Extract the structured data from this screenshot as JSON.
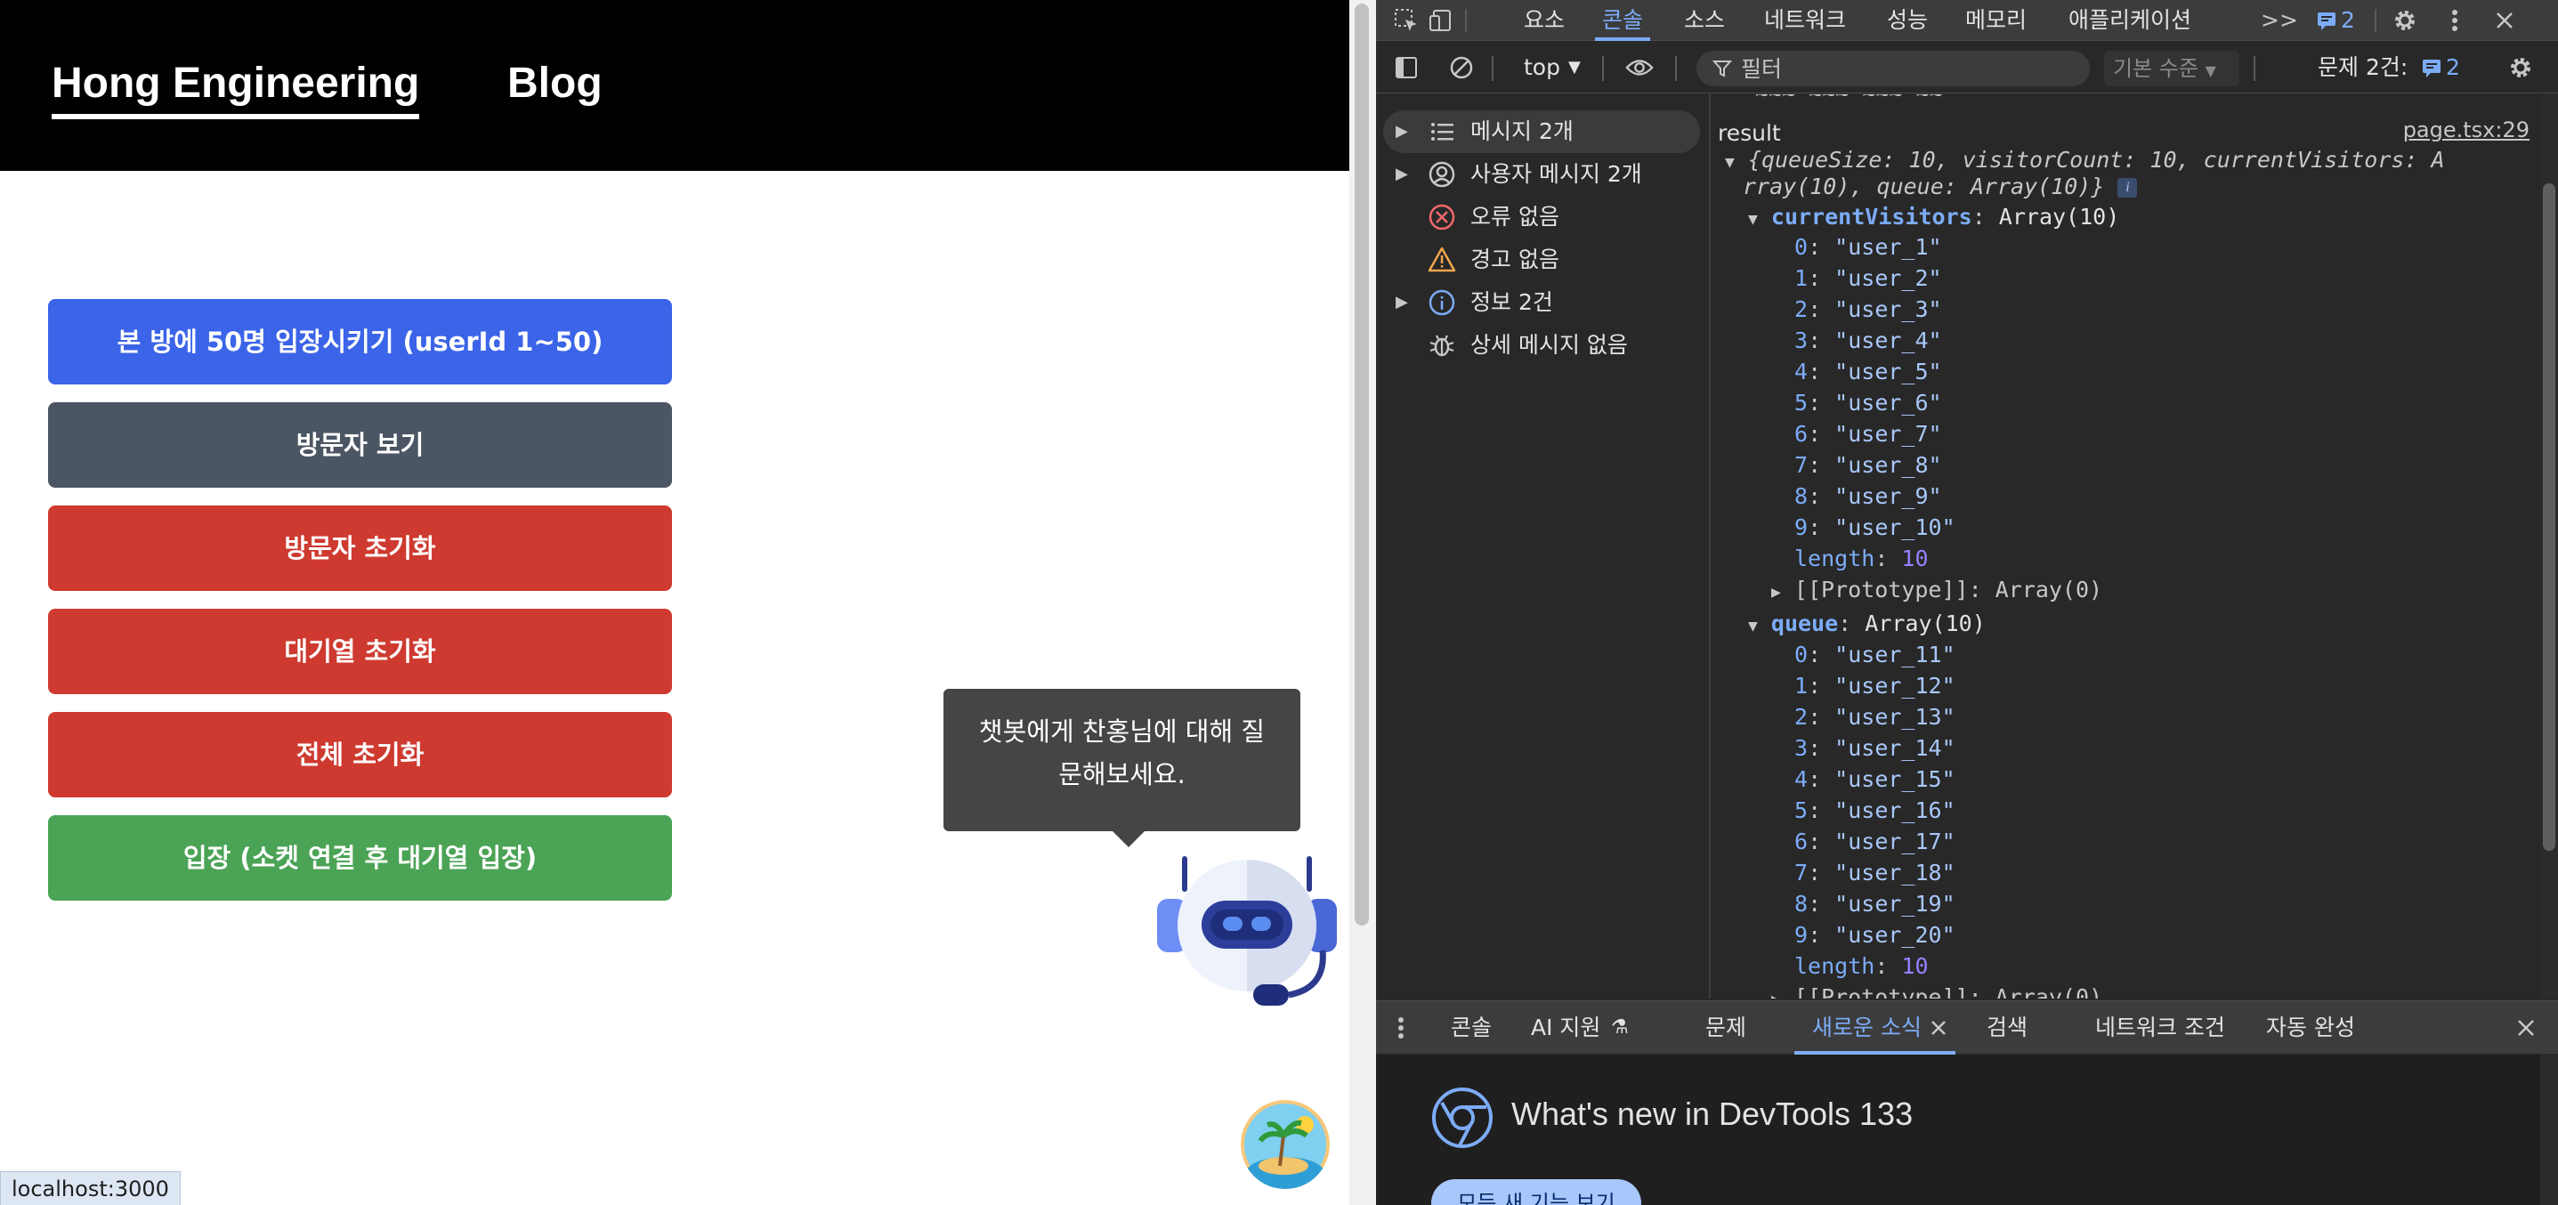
{
  "site": {
    "nav": {
      "home": "Hong Engineering",
      "blog": "Blog"
    },
    "buttons": [
      {
        "label": "본 방에 50명 입장시키기 (userId 1~50)",
        "color": "#3b64e8"
      },
      {
        "label": "방문자 보기",
        "color": "#4b5563"
      },
      {
        "label": "방문자 초기화",
        "color": "#ce3a2f"
      },
      {
        "label": "대기열 초기화",
        "color": "#ce3a2f"
      },
      {
        "label": "전체 초기화",
        "color": "#ce3a2f"
      },
      {
        "label": "입장 (소켓 연결 후 대기열 입장)",
        "color": "#4ba355"
      }
    ],
    "tooltip": "챗봇에게 찬홍님에 대해 질문해보세요.",
    "status_url": "localhost:3000"
  },
  "devtools": {
    "tabs": [
      "요소",
      "콘솔",
      "소스",
      "네트워크",
      "성능",
      "메모리",
      "애플리케이션"
    ],
    "active_tab": "콘솔",
    "more": ">>",
    "issue_count": "2",
    "toolbar": {
      "context": "top",
      "filter_placeholder": "필터",
      "level": "기본 수준",
      "issues_label": "문제 2건:",
      "issues_count": "2"
    },
    "sidebar": [
      {
        "label": "메시지 2개",
        "icon": "list-icon",
        "expandable": true
      },
      {
        "label": "사용자 메시지 2개",
        "icon": "user-icon",
        "expandable": true
      },
      {
        "label": "오류 없음",
        "icon": "error-icon",
        "expandable": false
      },
      {
        "label": "경고 없음",
        "icon": "warning-icon",
        "expandable": false
      },
      {
        "label": "정보 2건",
        "icon": "info-icon",
        "expandable": true
      },
      {
        "label": "상세 메시지 없음",
        "icon": "bug-icon",
        "expandable": false
      }
    ],
    "console": {
      "label": "result",
      "source": "page.tsx:29",
      "summary_line1": "{queueSize: 10, visitorCount: 10, currentVisitors: A",
      "summary_line2": "rray(10), queue: Array(10)}",
      "current_visitors_key": "currentVisitors",
      "current_visitors_type": "Array(10)",
      "current_visitors": [
        "\"user_1\"",
        "\"user_2\"",
        "\"user_3\"",
        "\"user_4\"",
        "\"user_5\"",
        "\"user_6\"",
        "\"user_7\"",
        "\"user_8\"",
        "\"user_9\"",
        "\"user_10\""
      ],
      "queue_key": "queue",
      "queue_type": "Array(10)",
      "queue": [
        "\"user_11\"",
        "\"user_12\"",
        "\"user_13\"",
        "\"user_14\"",
        "\"user_15\"",
        "\"user_16\"",
        "\"user_17\"",
        "\"user_18\"",
        "\"user_19\"",
        "\"user_20\""
      ],
      "length_key": "length",
      "length_value": "10",
      "prototype": "[[Prototype]]: Array(0)"
    },
    "drawer_tabs": [
      "콘솔",
      "AI 지원",
      "문제",
      "새로운 소식",
      "검색",
      "네트워크 조건",
      "자동 완성"
    ],
    "drawer_active": "새로운 소식",
    "whats_new_title": "What's new in DevTools 133",
    "whats_new_button": "모든 새 기능 보기"
  }
}
